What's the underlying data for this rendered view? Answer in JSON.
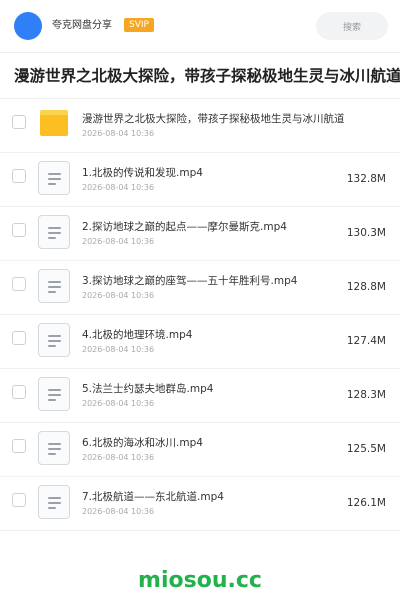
{
  "header": {
    "username": "夸克网盘分享",
    "badge": "SVIP",
    "search_label": "搜索"
  },
  "title": "漫游世界之北极大探险，带孩子探秘极地生灵与冰川航道",
  "items": [
    {
      "type": "folder",
      "icon": "folder-icon",
      "name": "漫游世界之北极大探险，带孩子探秘极地生灵与冰川航道",
      "date": "2026-08-04 10:36",
      "size": ""
    },
    {
      "type": "file",
      "icon": "video-file-icon",
      "name": "1.北极的传说和发现.mp4",
      "date": "2026-08-04 10:36",
      "size": "132.8M"
    },
    {
      "type": "file",
      "icon": "video-file-icon",
      "name": "2.探访地球之巅的起点——摩尔曼斯克.mp4",
      "date": "2026-08-04 10:36",
      "size": "130.3M"
    },
    {
      "type": "file",
      "icon": "video-file-icon",
      "name": "3.探访地球之巅的座驾——五十年胜利号.mp4",
      "date": "2026-08-04 10:36",
      "size": "128.8M"
    },
    {
      "type": "file",
      "icon": "video-file-icon",
      "name": "4.北极的地理环境.mp4",
      "date": "2026-08-04 10:36",
      "size": "127.4M"
    },
    {
      "type": "file",
      "icon": "video-file-icon",
      "name": "5.法兰士约瑟夫地群岛.mp4",
      "date": "2026-08-04 10:36",
      "size": "128.3M"
    },
    {
      "type": "file",
      "icon": "video-file-icon",
      "name": "6.北极的海冰和冰川.mp4",
      "date": "2026-08-04 10:36",
      "size": "125.5M"
    },
    {
      "type": "file",
      "icon": "video-file-icon",
      "name": "7.北极航道——东北航道.mp4",
      "date": "2026-08-04 10:36",
      "size": "126.1M"
    }
  ],
  "footer": {
    "watermark": "miosou.cc"
  },
  "colors": {
    "accent": "#2f80f7",
    "badge": "#f5a623",
    "folder": "#fbbf24",
    "watermark": "#22b14c"
  }
}
